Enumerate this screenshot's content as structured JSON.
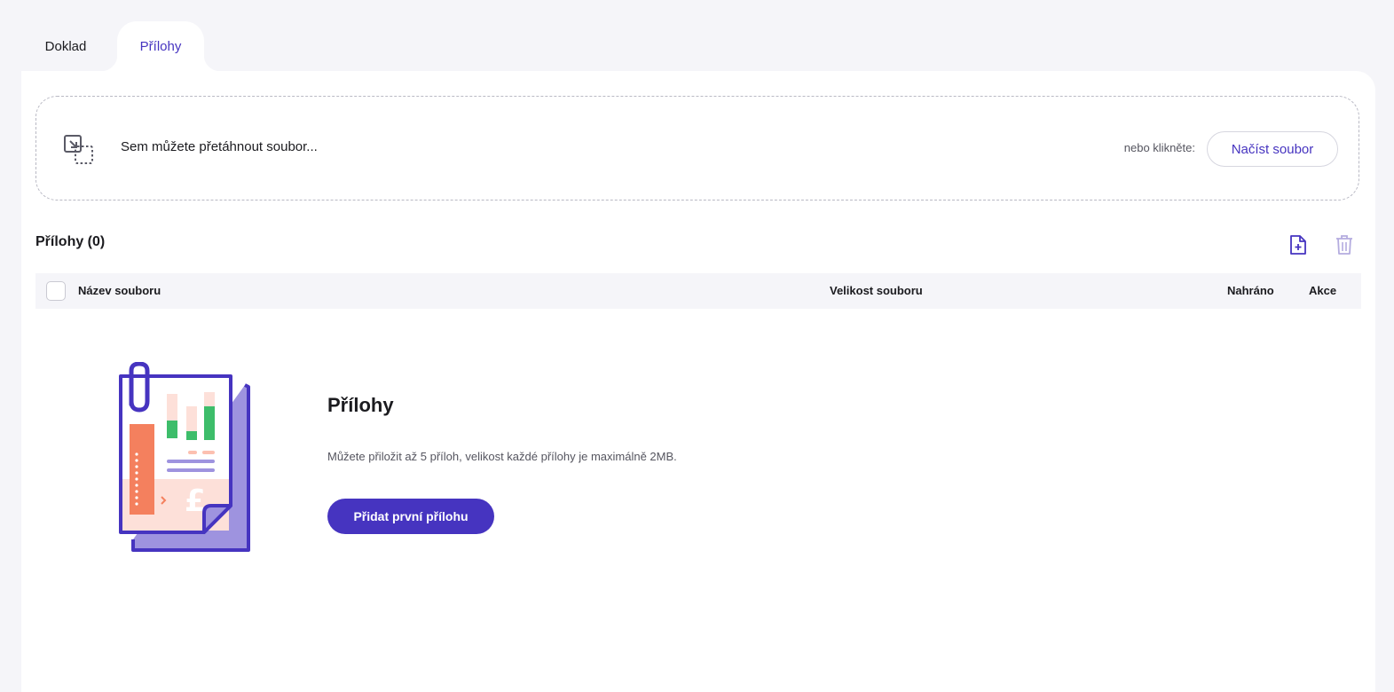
{
  "tabs": [
    {
      "label": "Doklad",
      "active": false
    },
    {
      "label": "Přílohy",
      "active": true
    }
  ],
  "dropzone": {
    "drag_text": "Sem můžete přetáhnout soubor...",
    "or_text": "nebo klikněte:",
    "button_label": "Načíst soubor",
    "icon": "drag-drop-icon"
  },
  "attachments": {
    "title": "Přílohy (0)",
    "actions": {
      "add_icon": "add-file-icon",
      "delete_icon": "trash-icon"
    },
    "columns": [
      "Název souboru",
      "Velikost souboru",
      "Nahráno",
      "Akce"
    ]
  },
  "empty_state": {
    "title": "Přílohy",
    "description": "Můžete přiložit až 5 příloh, velikost každé přílohy je maximálně 2MB.",
    "button_label": "Přidat první přílohu",
    "illustration_symbol": "£"
  },
  "colors": {
    "accent": "#4634c0",
    "background": "#f5f5f9",
    "panel": "#ffffff"
  }
}
